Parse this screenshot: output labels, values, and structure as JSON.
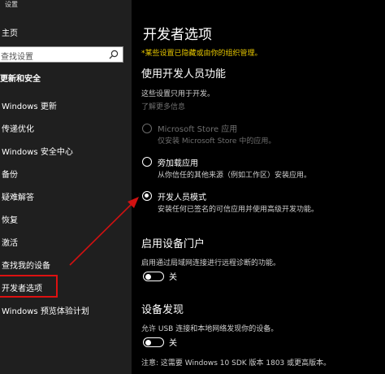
{
  "window": {
    "title": "设置"
  },
  "sidebar": {
    "home": "主页",
    "search_placeholder": "查找设置",
    "section_heading": "更新和安全",
    "items": [
      {
        "label": "Windows 更新"
      },
      {
        "label": "传递优化"
      },
      {
        "label": "Windows 安全中心"
      },
      {
        "label": "备份"
      },
      {
        "label": "疑难解答"
      },
      {
        "label": "恢复"
      },
      {
        "label": "激活"
      },
      {
        "label": "查找我的设备"
      },
      {
        "label": "开发者选项"
      },
      {
        "label": "Windows 预览体验计划"
      }
    ],
    "selected_index": 8
  },
  "main": {
    "title": "开发者选项",
    "org_notice": "*某些设置已隐藏或由你的组织管理。",
    "dev_features": {
      "heading": "使用开发人员功能",
      "description": "这些设置只用于开发。",
      "link": "了解更多信息",
      "options": [
        {
          "label": "Microsoft Store 应用",
          "description": "仅安装 Microsoft Store 中的应用。",
          "checked": false,
          "disabled": true
        },
        {
          "label": "旁加载应用",
          "description": "从你信任的其他来源（例如工作区）安装应用。",
          "checked": false,
          "disabled": false
        },
        {
          "label": "开发人员模式",
          "description": "安装任何已签名的可信应用并使用高级开发功能。",
          "checked": true,
          "disabled": false
        }
      ]
    },
    "device_portal": {
      "heading": "启用设备门户",
      "description": "启用通过局域网连接进行远程诊断的功能。",
      "toggle_label": "关",
      "toggle_on": false
    },
    "device_discovery": {
      "heading": "设备发现",
      "description": "允许 USB 连接和本地网络发现你的设备。",
      "toggle_label": "关",
      "toggle_on": false,
      "note": "注意: 这需要 Windows 10 SDK 版本 1803 或更高版本。"
    }
  },
  "colors": {
    "accent_highlight": "#d11111",
    "notice": "#e8c800"
  }
}
